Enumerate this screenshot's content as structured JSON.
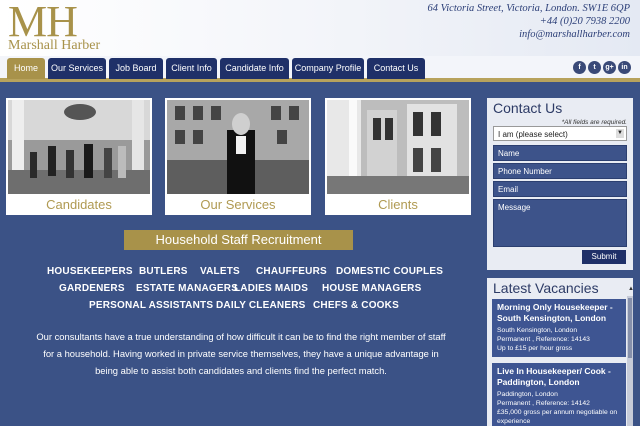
{
  "header": {
    "logo_initials": "MH",
    "logo_name": "Marshall Harber",
    "address": "64 Victoria Street, Victoria, London. SW1E 6QP",
    "phone": "+44 (0)20 7938 2200",
    "email": "info@marshallharber.com"
  },
  "nav": {
    "items": [
      {
        "label": "Home",
        "active": true
      },
      {
        "label": "Our Services"
      },
      {
        "label": "Job Board"
      },
      {
        "label": "Client Info"
      },
      {
        "label": "Candidate Info"
      },
      {
        "label": "Company Profile"
      },
      {
        "label": "Contact Us"
      }
    ]
  },
  "social": {
    "icons": [
      "facebook-icon",
      "twitter-icon",
      "google-plus-icon",
      "linkedin-icon"
    ],
    "glyphs": [
      "f",
      "t",
      "g+",
      "in"
    ]
  },
  "tiles": [
    {
      "caption": "Candidates"
    },
    {
      "caption": "Our Services"
    },
    {
      "caption": "Clients"
    }
  ],
  "main": {
    "heading": "Household Staff Recruitment",
    "roles": [
      "HOUSEKEEPERS",
      "BUTLERS",
      "VALETS",
      "CHAUFFEURS",
      "DOMESTIC COUPLES",
      "GARDENERS",
      "ESTATE MANAGERS",
      "LADIES MAIDS",
      "HOUSE MANAGERS",
      "PERSONAL ASSISTANTS",
      "DAILY CLEANERS",
      "CHEFS & COOKS"
    ],
    "paragraph": "Our consultants have a true understanding of how difficult it can be to find the right member of staff for a household. Having worked in private service themselves, they have a unique advantage in being able to assist both candidates and clients find the perfect match."
  },
  "contact": {
    "title": "Contact Us",
    "required_note": "*All fields are required.",
    "select_value": "I am (please select)",
    "name_placeholder": "Name",
    "phone_placeholder": "Phone Number",
    "email_placeholder": "Email",
    "message_placeholder": "Message",
    "submit_label": "Submit"
  },
  "vacancies": {
    "title": "Latest Vacancies",
    "items": [
      {
        "title": "Morning Only Housekeeper - South Kensington, London",
        "location": "South Kensington, London",
        "type": "Permanent , Reference: 14143",
        "salary": "Up to £15 per hour gross"
      },
      {
        "title": "Live In Housekeeper/ Cook - Paddington, London",
        "location": "Paddington, London",
        "type": "Permanent , Reference: 14142",
        "salary": "£35,000 gross per annum negotiable on experience"
      }
    ]
  },
  "colors": {
    "accent_gold": "#a8924a",
    "navy": "#1f3068",
    "body_blue": "#3b5286"
  }
}
